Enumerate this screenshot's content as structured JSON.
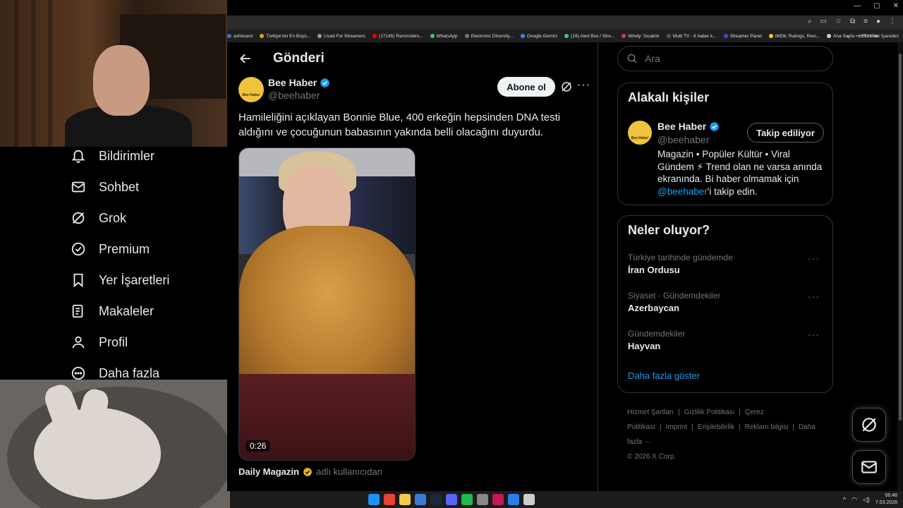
{
  "browser": {
    "bookmarks": [
      {
        "label": "ashboard",
        "color": "#3b6fd8"
      },
      {
        "label": "Türkiye'nin En Büyü...",
        "color": "#e0a020"
      },
      {
        "label": "Livad For Streamers",
        "color": "#999999"
      },
      {
        "label": "(17145) Rammstein...",
        "color": "#ff0000"
      },
      {
        "label": "WhatsApp",
        "color": "#25d366"
      },
      {
        "label": "Electronic Diversity...",
        "color": "#777777"
      },
      {
        "label": "Google Gemini",
        "color": "#4285f4"
      },
      {
        "label": "(19) Alert Box / Stre...",
        "color": "#31c3a2"
      },
      {
        "label": "Windy: Sıcaklık",
        "color": "#d23c3c"
      },
      {
        "label": "Multi TV - 6 haber k...",
        "color": "#555555"
      },
      {
        "label": "Streamer Panel",
        "color": "#3355cc"
      },
      {
        "label": "IMDb: Ratings, Revi...",
        "color": "#f5c518"
      },
      {
        "label": "Ana Sayfa • HBO Max",
        "color": "#cccccc"
      }
    ],
    "bookmarks_overflow": "»",
    "all_bookmarks": "Tüm Yer İşaretleri"
  },
  "sidebar": {
    "items": [
      {
        "label": "Bildirimler",
        "icon": "bell-icon"
      },
      {
        "label": "Sohbet",
        "icon": "mail-icon"
      },
      {
        "label": "Grok",
        "icon": "grok-icon"
      },
      {
        "label": "Premium",
        "icon": "verified-badge-icon"
      },
      {
        "label": "Yer İşaretleri",
        "icon": "bookmark-icon"
      },
      {
        "label": "Makaleler",
        "icon": "article-icon"
      },
      {
        "label": "Profil",
        "icon": "person-icon"
      },
      {
        "label": "Daha fazla",
        "icon": "more-circle-icon"
      }
    ]
  },
  "post": {
    "header_title": "Gönderi",
    "author_name": "Bee Haber",
    "author_handle": "@beehaber",
    "avatar_text": "Bee Haber",
    "follow_label": "Abone ol",
    "text": "Hamileliğini açıklayan Bonnie Blue, 400 erkeğin hepsinden DNA testi aldığını ve çocuğunun babasının yakında belli olacağını duyurdu.",
    "video_duration": "0:26",
    "credit_name": "Daily Magazin",
    "credit_suffix": "adlı kullanıcıdan"
  },
  "right": {
    "search_placeholder": "Ara",
    "related_title": "Alakalı kişiler",
    "related": {
      "name": "Bee Haber",
      "handle": "@beehaber",
      "button": "Takip ediliyor",
      "bio_prefix": "Magazin • Popüler Kültür • Viral Gündem ⚡ Trend olan ne varsa anında ekranında. Bi haber olmamak için ",
      "bio_link": "@beehaber",
      "bio_suffix": "'i takip edin."
    },
    "trends_title": "Neler oluyor?",
    "trends": [
      {
        "meta": "Türkiye tarihinde gündemde",
        "name": "İran Ordusu"
      },
      {
        "meta": "Siyaset · Gündemdekiler",
        "name": "Azerbaycan"
      },
      {
        "meta": "Gündemdekiler",
        "name": "Hayvan"
      }
    ],
    "show_more": "Daha fazla göster",
    "footer_links": [
      "Hizmet Şartları",
      "|",
      "Gizlilik Politikası",
      "|",
      "Çerez Politikası",
      "|",
      "Imprint",
      "|",
      "Erişilebilirlik",
      "|",
      "Reklam bilgisi",
      "|",
      "Daha fazla ···"
    ],
    "copyright": "© 2026 X Corp."
  },
  "taskbar": {
    "time": "06:48",
    "date": "7.03.2026",
    "apps": [
      "#1e90ff",
      "#e94235",
      "#f2c94c",
      "#3a7bd5",
      "#1b2838",
      "#5865f2",
      "#1db954",
      "#888888",
      "#c2185b",
      "#2b7de9",
      "#cccccc"
    ]
  }
}
